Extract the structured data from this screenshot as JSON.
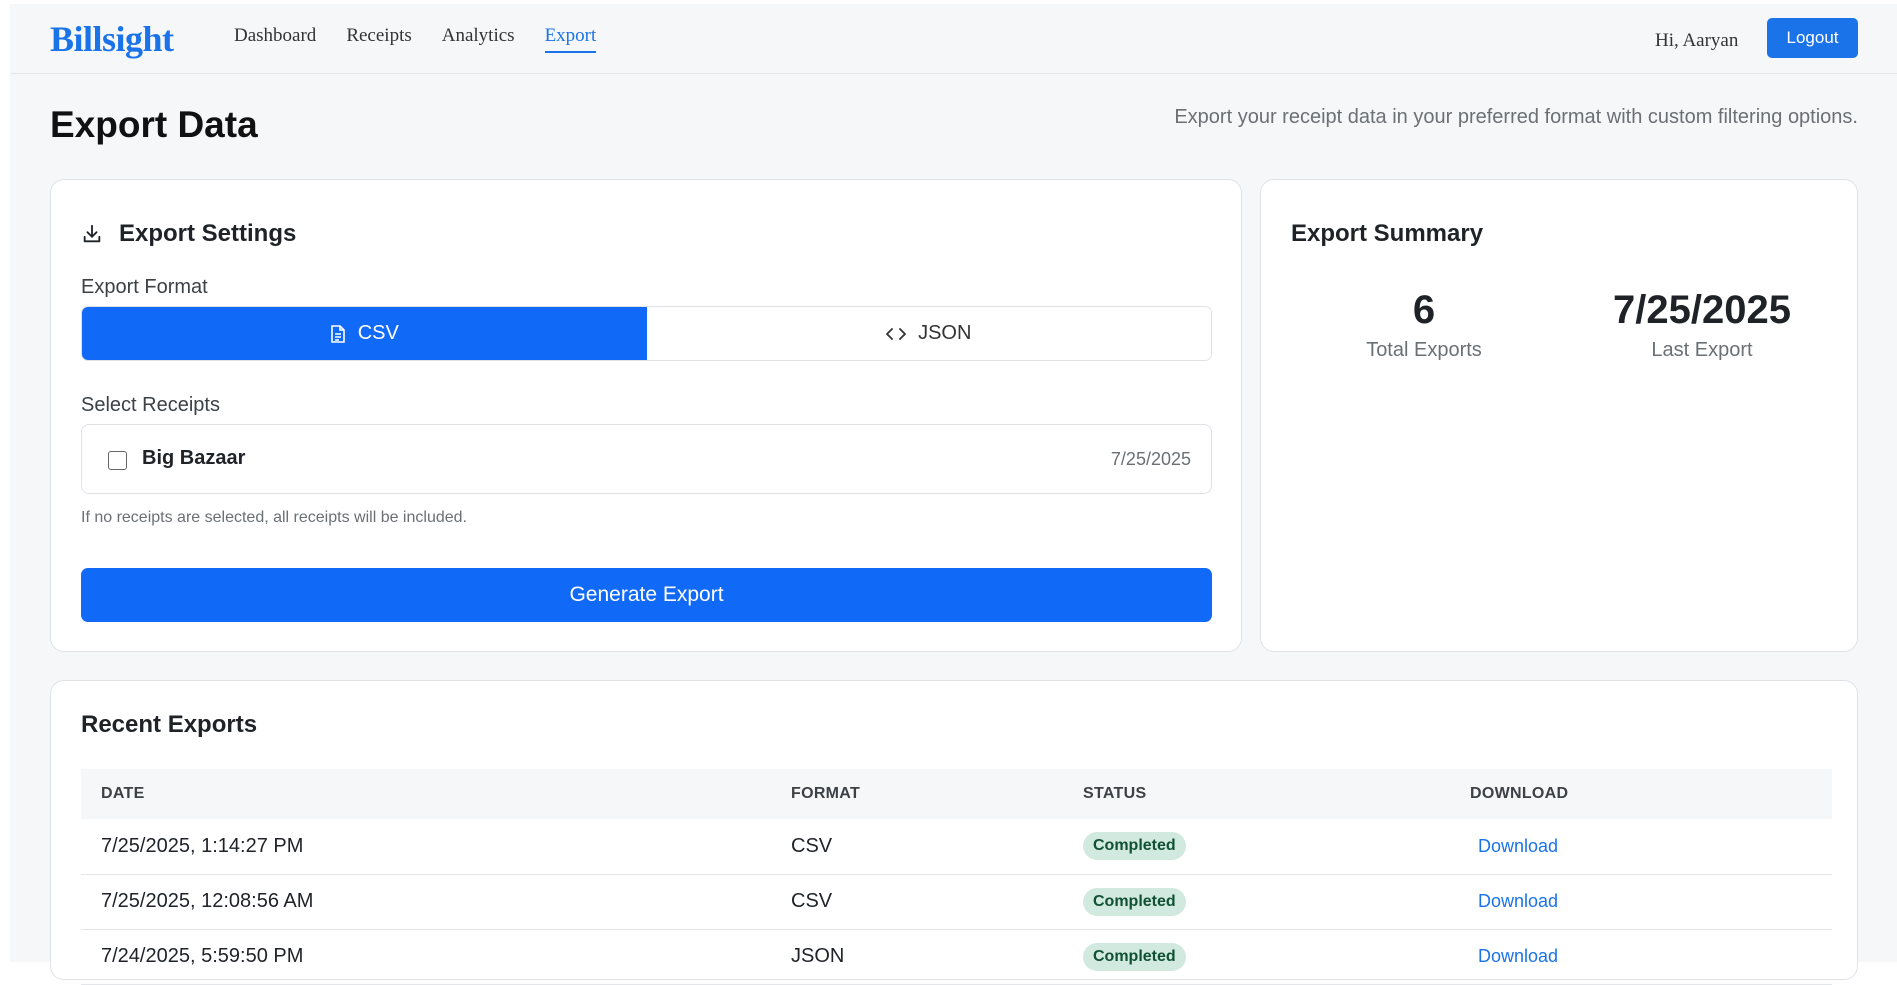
{
  "header": {
    "brand": "Billsight",
    "nav": [
      {
        "label": "Dashboard",
        "active": false
      },
      {
        "label": "Receipts",
        "active": false
      },
      {
        "label": "Analytics",
        "active": false
      },
      {
        "label": "Export",
        "active": true
      }
    ],
    "greeting": "Hi, Aaryan",
    "logout_label": "Logout"
  },
  "page": {
    "title": "Export Data",
    "subtitle": "Export your receipt data in your preferred format with custom filtering options."
  },
  "settings": {
    "heading": "Export Settings",
    "format_label": "Export Format",
    "formats": [
      {
        "label": "CSV",
        "icon": "file-icon",
        "selected": true
      },
      {
        "label": "JSON",
        "icon": "code-icon",
        "selected": false
      }
    ],
    "select_label": "Select Receipts",
    "receipts": [
      {
        "name": "Big Bazaar",
        "date": "7/25/2025",
        "checked": false
      }
    ],
    "note": "If no receipts are selected, all receipts will be included.",
    "generate_label": "Generate Export"
  },
  "summary": {
    "heading": "Export Summary",
    "total_exports": "6",
    "total_label": "Total Exports",
    "last_export": "7/25/2025",
    "last_label": "Last Export"
  },
  "recent": {
    "heading": "Recent Exports",
    "columns": [
      "DATE",
      "FORMAT",
      "STATUS",
      "DOWNLOAD"
    ],
    "rows": [
      {
        "date": "7/25/2025, 1:14:27 PM",
        "format": "CSV",
        "status": "Completed",
        "download": "Download"
      },
      {
        "date": "7/25/2025, 12:08:56 AM",
        "format": "CSV",
        "status": "Completed",
        "download": "Download"
      },
      {
        "date": "7/24/2025, 5:59:50 PM",
        "format": "JSON",
        "status": "Completed",
        "download": "Download"
      }
    ]
  },
  "colors": {
    "accent": "#1a73e8",
    "primary_button": "#1169f7",
    "badge_bg": "#d1e9df",
    "badge_text": "#0f5132"
  }
}
